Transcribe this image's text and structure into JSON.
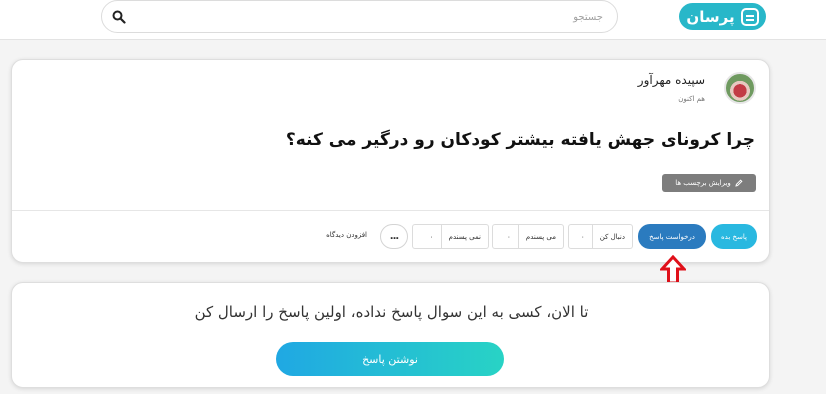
{
  "header": {
    "logo_text": "پرسان",
    "search_placeholder": "جستجو",
    "search_value": ""
  },
  "question": {
    "author": "سپیده مهرآور",
    "time": "هم اکنون",
    "title": "چرا کرونای جهش یافته بیشتر کودکان رو درگیر می کنه؟",
    "edit_tags_label": "ویرایش برچسب ها",
    "actions": {
      "answer_label": "پاسخ بده",
      "request_answer_label": "درخواست پاسخ",
      "follow_label": "دنبال کن",
      "follow_count": "۰",
      "like_label": "می پسندم",
      "like_count": "۰",
      "dislike_label": "نمی پسندم",
      "dislike_count": "۰",
      "more_label": "...",
      "add_view_label": "افزودن دیدگاه"
    }
  },
  "empty_state": {
    "message": "تا الان، کسی به این سوال پاسخ نداده، اولین پاسخ را ارسال کن",
    "write_answer_label": "نوشتن پاسخ"
  },
  "colors": {
    "brand": "#28b7c9",
    "answer_button": "#29b8e0",
    "request_button": "#2b7bbf",
    "annotation_arrow": "#e0101a"
  }
}
